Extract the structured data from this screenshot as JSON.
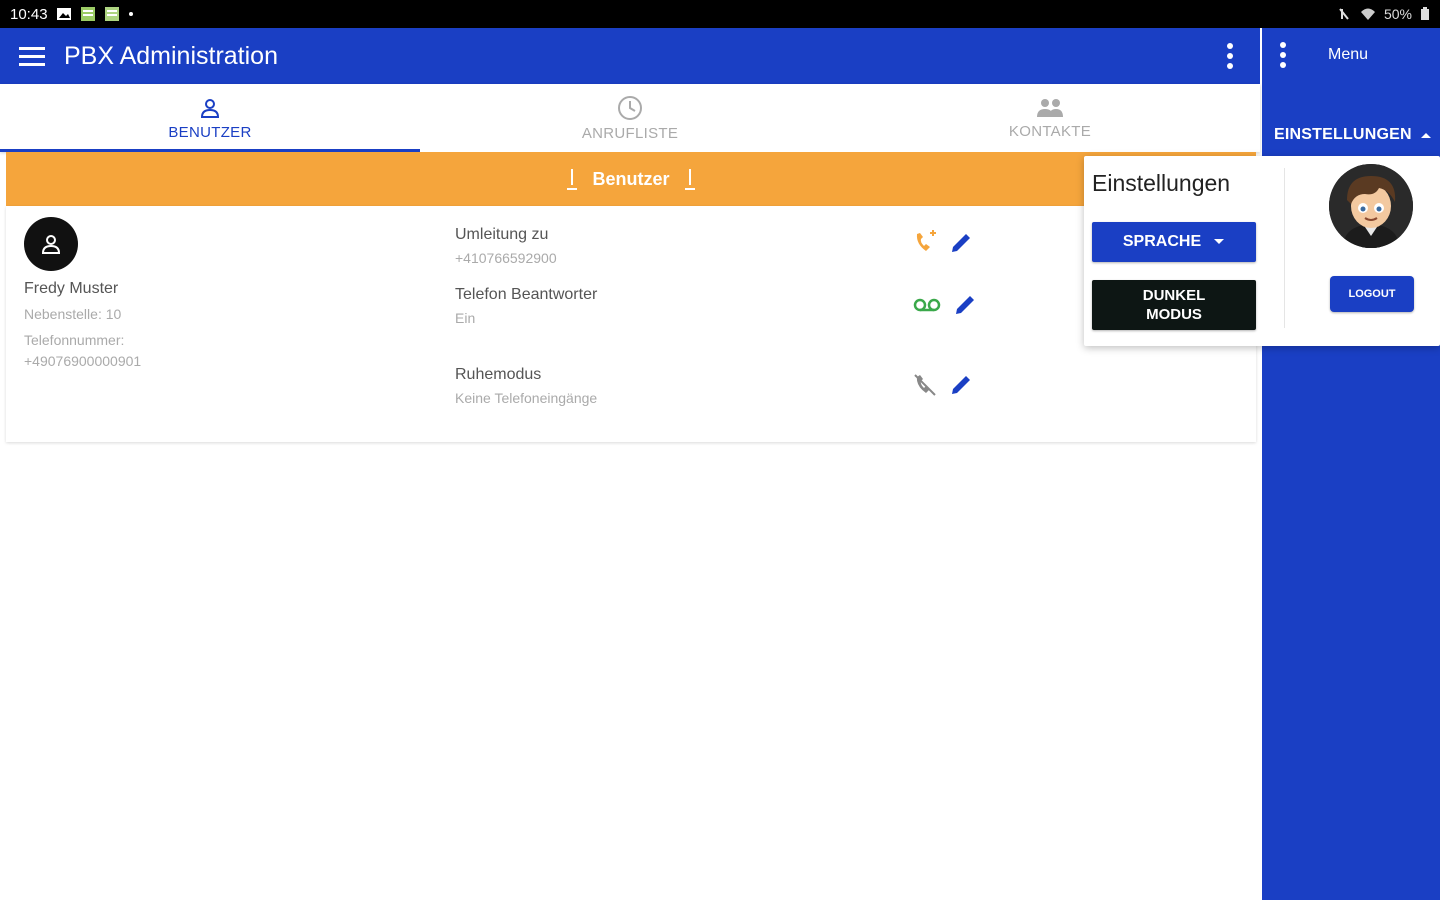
{
  "status": {
    "time": "10:43",
    "battery": "50%"
  },
  "app": {
    "title": "PBX Administration"
  },
  "tabs": [
    {
      "label": "BENUTZER",
      "icon": "person-icon",
      "active": true
    },
    {
      "label": "ANRUFLISTE",
      "icon": "clock-icon",
      "active": false
    },
    {
      "label": "KONTAKTE",
      "icon": "group-icon",
      "active": false
    }
  ],
  "banner": {
    "label": "Benutzer"
  },
  "user": {
    "name": "Fredy Muster",
    "extension": "Nebenstelle: 10",
    "phone_label": "Telefonnummer:",
    "phone": "+49076900000901"
  },
  "settings": [
    {
      "title": "Umleitung zu",
      "value": "+410766592900",
      "icon": "call-forward-icon",
      "icon_color": "#f5a53c"
    },
    {
      "title": "Telefon Beantworter",
      "value": "Ein",
      "icon": "voicemail-icon",
      "icon_color": "#3aa84a"
    },
    {
      "title": "Ruhemodus",
      "value": "Keine Telefoneingänge",
      "icon": "phone-disabled-icon",
      "icon_color": "#888888"
    }
  ],
  "sidebar": {
    "menu_label": "Menu",
    "settings_label": "EINSTELLUNGEN"
  },
  "panel": {
    "title": "Einstellungen",
    "language_button": "SPRACHE",
    "dark_mode_line1": "DUNKEL",
    "dark_mode_line2": "MODUS",
    "logout_button": "LOGOUT"
  },
  "colors": {
    "primary": "#1a3fc4",
    "accent": "#f5a53c"
  }
}
